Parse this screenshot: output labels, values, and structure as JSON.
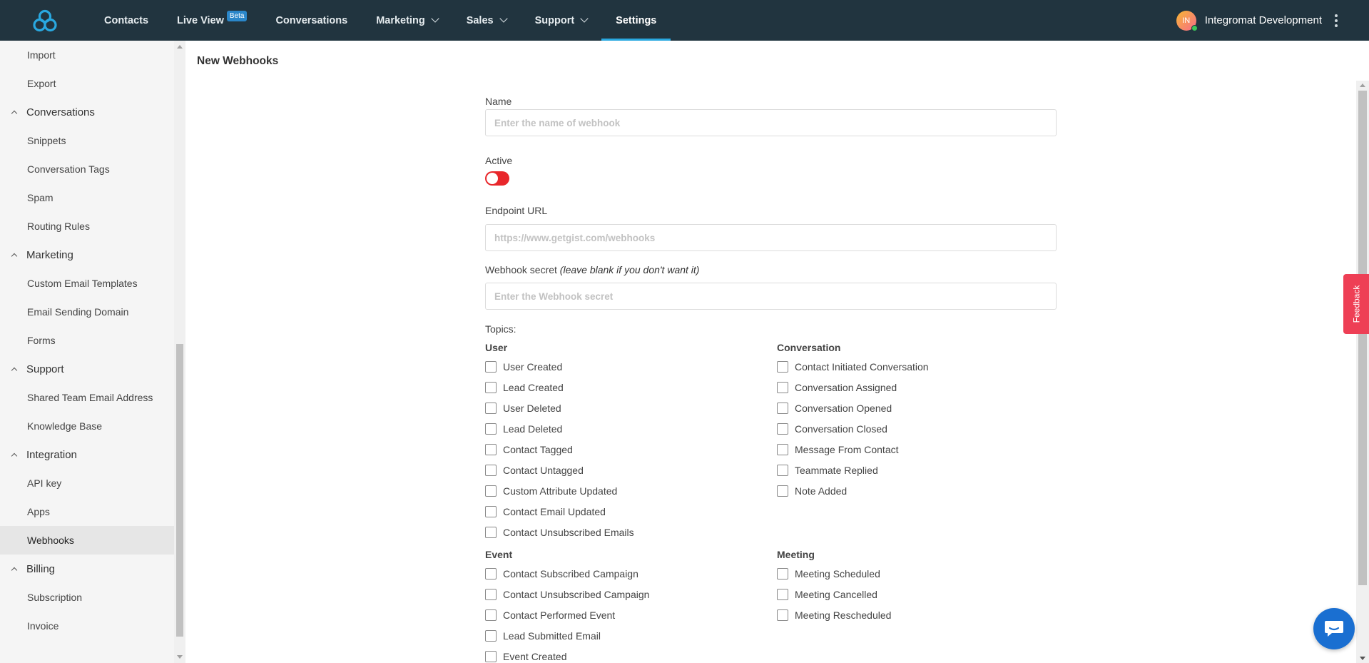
{
  "topnav": {
    "items": [
      {
        "label": "Contacts",
        "dropdown": false
      },
      {
        "label": "Live View",
        "badge": "Beta",
        "dropdown": false
      },
      {
        "label": "Conversations",
        "dropdown": false
      },
      {
        "label": "Marketing",
        "dropdown": true
      },
      {
        "label": "Sales",
        "dropdown": true
      },
      {
        "label": "Support",
        "dropdown": true
      },
      {
        "label": "Settings",
        "dropdown": false,
        "active": true
      }
    ],
    "avatar_initials": "IN",
    "account_name": "Integromat Development"
  },
  "sidebar": {
    "items": [
      {
        "label": "Import",
        "type": "child"
      },
      {
        "label": "Export",
        "type": "child"
      },
      {
        "label": "Conversations",
        "type": "parent"
      },
      {
        "label": "Snippets",
        "type": "child"
      },
      {
        "label": "Conversation Tags",
        "type": "child"
      },
      {
        "label": "Spam",
        "type": "child"
      },
      {
        "label": "Routing Rules",
        "type": "child"
      },
      {
        "label": "Marketing",
        "type": "parent"
      },
      {
        "label": "Custom Email Templates",
        "type": "child"
      },
      {
        "label": "Email Sending Domain",
        "type": "child"
      },
      {
        "label": "Forms",
        "type": "child"
      },
      {
        "label": "Support",
        "type": "parent"
      },
      {
        "label": "Shared Team Email Address",
        "type": "child"
      },
      {
        "label": "Knowledge Base",
        "type": "child"
      },
      {
        "label": "Integration",
        "type": "parent"
      },
      {
        "label": "API key",
        "type": "child"
      },
      {
        "label": "Apps",
        "type": "child"
      },
      {
        "label": "Webhooks",
        "type": "child",
        "selected": true
      },
      {
        "label": "Billing",
        "type": "parent"
      },
      {
        "label": "Subscription",
        "type": "child"
      },
      {
        "label": "Invoice",
        "type": "child"
      }
    ]
  },
  "page": {
    "title": "New Webhooks"
  },
  "form": {
    "name_label": "Name",
    "name_placeholder": "Enter the name of webhook",
    "active_label": "Active",
    "active_value": false,
    "endpoint_label": "Endpoint URL",
    "endpoint_placeholder": "https://www.getgist.com/webhooks",
    "secret_label": "Webhook secret",
    "secret_hint": "(leave blank if you don't want it)",
    "secret_placeholder": "Enter the Webhook secret",
    "topics_label": "Topics:",
    "groups": {
      "user": {
        "title": "User",
        "items": [
          "User Created",
          "Lead Created",
          "User Deleted",
          "Lead Deleted",
          "Contact Tagged",
          "Contact Untagged",
          "Custom Attribute Updated",
          "Contact Email Updated",
          "Contact Unsubscribed Emails"
        ]
      },
      "conversation": {
        "title": "Conversation",
        "items": [
          "Contact Initiated Conversation",
          "Conversation Assigned",
          "Conversation Opened",
          "Conversation Closed",
          "Message From Contact",
          "Teammate Replied",
          "Note Added"
        ]
      },
      "event": {
        "title": "Event",
        "items": [
          "Contact Subscribed Campaign",
          "Contact Unsubscribed Campaign",
          "Contact Performed Event",
          "Lead Submitted Email",
          "Event Created"
        ]
      },
      "meeting": {
        "title": "Meeting",
        "items": [
          "Meeting Scheduled",
          "Meeting Cancelled",
          "Meeting Rescheduled"
        ]
      }
    }
  },
  "feedback_label": "Feedback",
  "colors": {
    "nav_bg": "#21343f",
    "nav_active_underline": "#29a8e0",
    "toggle_off": "#e8272b",
    "feedback": "#ee3f55",
    "chat": "#1a6fd1"
  },
  "icons": {
    "logo": "gist-logo-icon",
    "chat": "chat-bubble-icon",
    "kebab": "kebab-menu-icon"
  }
}
